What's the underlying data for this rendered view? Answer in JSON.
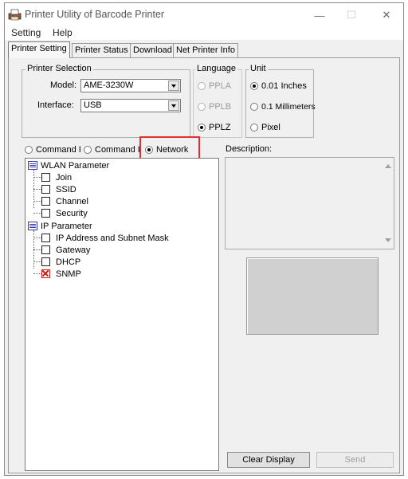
{
  "window": {
    "title": "Printer Utility of Barcode Printer",
    "controls": {
      "minimize": "—",
      "maximize": "☐",
      "close": "✕"
    }
  },
  "menu": [
    "Setting",
    "Help"
  ],
  "tabs": [
    {
      "label": "Printer Setting",
      "active": true
    },
    {
      "label": "Printer Status",
      "active": false
    },
    {
      "label": "Download",
      "active": false
    },
    {
      "label": "Net Printer Info",
      "active": false
    }
  ],
  "printer_selection": {
    "legend": "Printer Selection",
    "model_label": "Model:",
    "model_value": "AME-3230W",
    "interface_label": "Interface:",
    "interface_value": "USB"
  },
  "language": {
    "legend": "Language",
    "options": [
      {
        "label": "PPLA",
        "checked": false,
        "enabled": false
      },
      {
        "label": "PPLB",
        "checked": false,
        "enabled": false
      },
      {
        "label": "PPLZ",
        "checked": true,
        "enabled": true
      }
    ]
  },
  "unit": {
    "legend": "Unit",
    "options": [
      {
        "label": "0.01 Inches",
        "checked": true
      },
      {
        "label": "0.1 Millimeters",
        "checked": false
      },
      {
        "label": "Pixel",
        "checked": false
      }
    ]
  },
  "command_modes": [
    {
      "label": "Command I",
      "checked": false
    },
    {
      "label": "Command I",
      "checked": false
    },
    {
      "label": "Network",
      "checked": true
    }
  ],
  "tree": {
    "groups": [
      {
        "label": "WLAN Parameter",
        "items": [
          "Join",
          "SSID",
          "Channel",
          "Security"
        ]
      },
      {
        "label": "IP Parameter",
        "items": [
          "IP Address and Subnet Mask",
          "Gateway",
          "DHCP",
          "SNMP"
        ]
      }
    ],
    "checked_item": "SNMP"
  },
  "description": {
    "label": "Description:"
  },
  "buttons": {
    "clear_display": "Clear Display",
    "send": "Send"
  },
  "colors": {
    "highlight": "#e03030",
    "tree_folder": "#3a3ab0",
    "checked_mark": "#c02020"
  }
}
